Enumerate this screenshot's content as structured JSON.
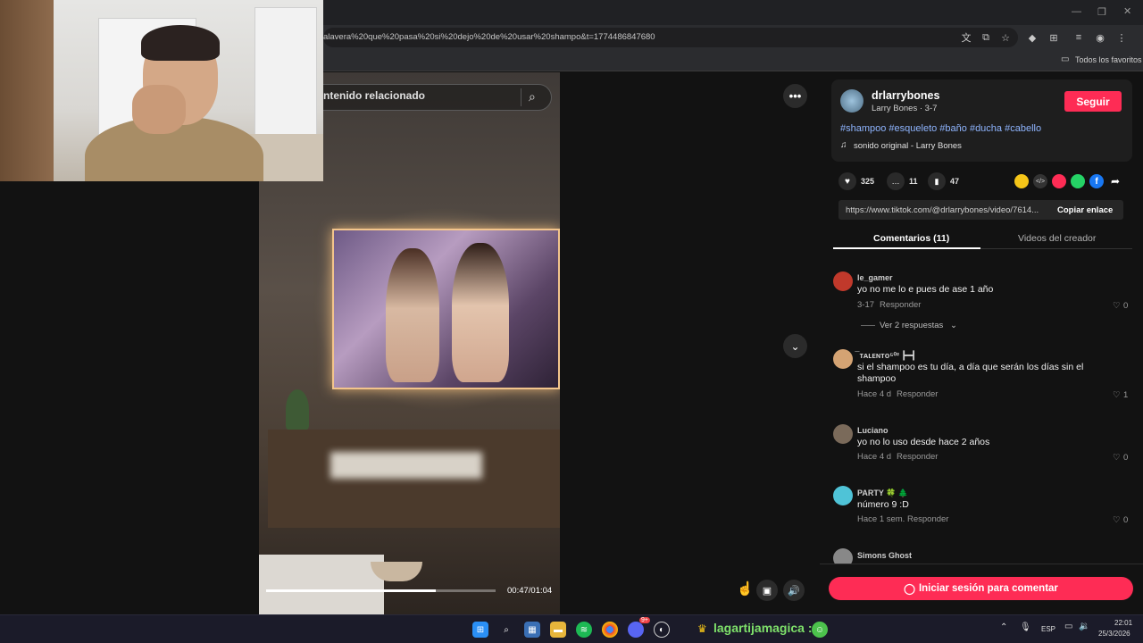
{
  "browser": {
    "url": "alavera%20que%20pasa%20si%20dejo%20de%20usar%20shampo&t=1774486847680",
    "bookmarks_folder": "Todos los favoritos"
  },
  "video": {
    "search_placeholder": "ntenido relacionado",
    "time": "00:47/01:04",
    "progress": 0.74
  },
  "creator": {
    "username": "drlarrybones",
    "display": "Larry Bones · 3-7",
    "follow_label": "Seguir",
    "hashtags": "#shampoo #esqueleto #baño #ducha #cabello",
    "sound": "sonido original - Larry Bones"
  },
  "stats": {
    "likes": "325",
    "comments": "11",
    "saves": "47"
  },
  "link": {
    "url": "https://www.tiktok.com/@drlarrybones/video/7614...",
    "copy_label": "Copiar enlace"
  },
  "tabs": {
    "comments": "Comentarios (11)",
    "videos": "Videos del creador"
  },
  "comments": [
    {
      "user": "le_gamer",
      "text": "yo no me lo e pues de ase 1 año",
      "time": "3-17",
      "reply": "Responder",
      "likes": "0",
      "more": "Ver 2 respuestas",
      "avatar_color": "#c0392b"
    },
    {
      "user": "̅̅ ᴛᴀʟᴇɴᴛᴏ⁵⁰² ┣━┫",
      "text": "si el shampoo es tu día, a día que serán los días sin el shampoo",
      "time": "Hace 4 d",
      "reply": "Responder",
      "likes": "1",
      "avatar_color": "#d4a373"
    },
    {
      "user": "Luciano",
      "text": "yo no lo uso desde hace 2 años",
      "time": "Hace 4 d",
      "reply": "Responder",
      "likes": "0",
      "avatar_color": "#7a6a5a"
    },
    {
      "user": "PARTY 🍀 🌲",
      "text": "número 9 :D",
      "time": "Hace 1 sem.",
      "reply": "Responder",
      "likes": "0",
      "avatar_color": "#4fc3d7"
    },
    {
      "user": "Simons Ghost",
      "avatar_color": "#888888"
    }
  ],
  "login_label": "Iniciar sesión para comentar",
  "taskbar": {
    "channel": "lagartijamagica :",
    "lang": "ESP",
    "time": "22:01",
    "date": "25/3/2026",
    "discord_badge": "9+"
  }
}
